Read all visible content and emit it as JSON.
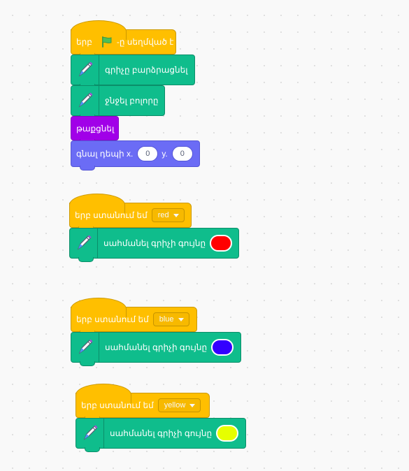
{
  "scripts": [
    {
      "hat": {
        "before": "երբ",
        "after": "-ը սեղմված է",
        "icon": "green-flag-icon"
      },
      "blocks": [
        {
          "category": "pen",
          "label": "գրիչը բարձրացնել"
        },
        {
          "category": "pen",
          "label": "ջնջել բոլորը"
        },
        {
          "category": "looks",
          "label": "թաքցնել"
        },
        {
          "category": "motion",
          "label": "գնալ դեպի x.",
          "x_value": "0",
          "y_label": "y.",
          "y_value": "0"
        }
      ]
    },
    {
      "hat": {
        "label": "երբ ստանում եմ",
        "message": "red"
      },
      "blocks": [
        {
          "category": "pen",
          "label": "սահմանել գրիչի գույնը",
          "color": "#ff0000"
        }
      ]
    },
    {
      "hat": {
        "label": "երբ ստանում եմ",
        "message": "blue"
      },
      "blocks": [
        {
          "category": "pen",
          "label": "սահմանել գրիչի գույնը",
          "color": "#3300ff"
        }
      ]
    },
    {
      "hat": {
        "label": "երբ ստանում եմ",
        "message": "yellow"
      },
      "blocks": [
        {
          "category": "pen",
          "label": "սահմանել գրիչի գույնը",
          "color": "#e6ff00"
        }
      ]
    }
  ],
  "colors": {
    "events": "#ffbf00",
    "pen": "#0fbd8c",
    "looks": "#a100e8",
    "motion": "#6b6cf5",
    "background": "#f9f9f9"
  }
}
